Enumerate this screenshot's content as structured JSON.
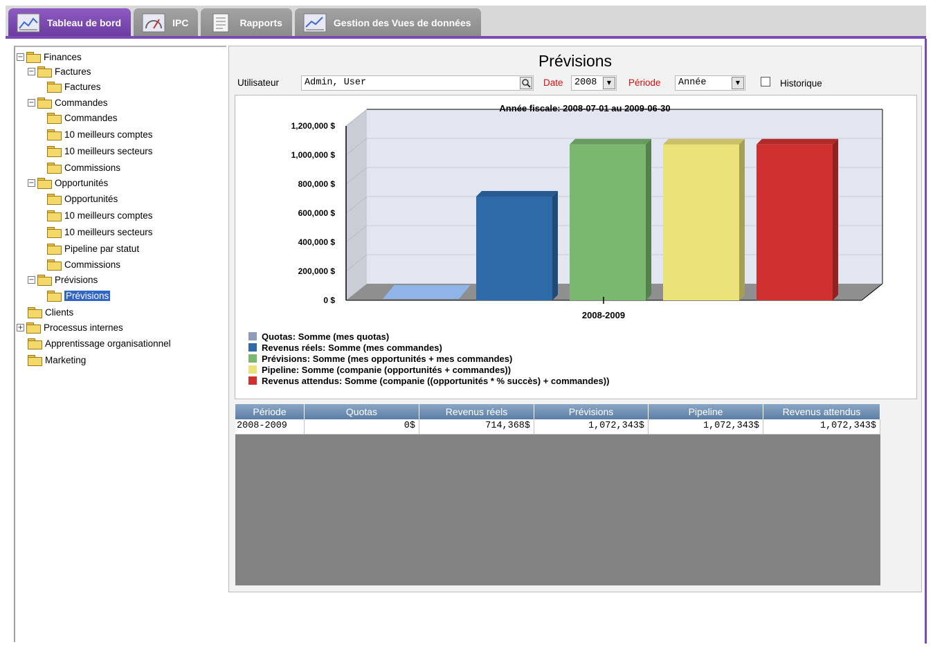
{
  "tabs": [
    {
      "label": "Tableau de bord",
      "icon": "dashboard-chart-icon",
      "active": true
    },
    {
      "label": "IPC",
      "icon": "kpi-gauge-icon",
      "active": false
    },
    {
      "label": "Rapports",
      "icon": "report-document-icon",
      "active": false
    },
    {
      "label": "Gestion des Vues de données",
      "icon": "data-views-chart-icon",
      "active": false
    }
  ],
  "tree": [
    {
      "label": "Finances",
      "level": 0,
      "expander": "−"
    },
    {
      "label": "Factures",
      "level": 1,
      "expander": "−"
    },
    {
      "label": "Factures",
      "level": 2
    },
    {
      "label": "Commandes",
      "level": 1,
      "expander": "−"
    },
    {
      "label": "Commandes",
      "level": 2
    },
    {
      "label": "10 meilleurs comptes",
      "level": 2
    },
    {
      "label": "10 meilleurs secteurs",
      "level": 2
    },
    {
      "label": "Commissions",
      "level": 2
    },
    {
      "label": "Opportunités",
      "level": 1,
      "expander": "−"
    },
    {
      "label": "Opportunités",
      "level": 2
    },
    {
      "label": "10 meilleurs comptes",
      "level": 2
    },
    {
      "label": "10 meilleurs secteurs",
      "level": 2
    },
    {
      "label": "Pipeline par statut",
      "level": 2
    },
    {
      "label": "Commissions",
      "level": 2
    },
    {
      "label": "Prévisions",
      "level": 1,
      "expander": "−"
    },
    {
      "label": "Prévisions",
      "level": 2,
      "selected": true
    },
    {
      "label": "Clients",
      "level": 0
    },
    {
      "label": "Processus internes",
      "level": 0,
      "expander": "+"
    },
    {
      "label": "Apprentissage organisationnel",
      "level": 0
    },
    {
      "label": "Marketing",
      "level": 0
    }
  ],
  "main": {
    "title": "Prévisions",
    "user_label": "Utilisateur",
    "user_value": "Admin, User",
    "date_label": "Date",
    "date_value": "2008",
    "period_label": "Période",
    "period_value": "Année",
    "history_label": "Historique",
    "history_checked": false
  },
  "chart_data": {
    "type": "bar",
    "title": "Année fiscale: 2008-07-01 au 2009-06-30",
    "categories": [
      "2008-2009"
    ],
    "series": [
      {
        "name": "Quotas: Somme (mes quotas)",
        "values": [
          0
        ],
        "color": "#8fb4e8"
      },
      {
        "name": "Revenus réels: Somme (mes commandes)",
        "values": [
          714368
        ],
        "color": "#2f6aa8"
      },
      {
        "name": "Prévisions: Somme (mes opportunités +  mes commandes)",
        "values": [
          1072343
        ],
        "color": "#7ab870"
      },
      {
        "name": "Pipeline: Somme (companie (opportunités  +  commandes))",
        "values": [
          1072343
        ],
        "color": "#ece27a"
      },
      {
        "name": "Revenus attendus: Somme (companie ((opportunités * % succès) + commandes))",
        "values": [
          1072343
        ],
        "color": "#d03030"
      }
    ],
    "legend_swatches": [
      "#8d9cb8",
      "#2f6aa8",
      "#7ab870",
      "#ece27a",
      "#d03030"
    ],
    "yticks": [
      "0 $",
      "200,000 $",
      "400,000 $",
      "600,000 $",
      "800,000 $",
      "1,000,000 $",
      "1,200,000 $"
    ],
    "ylim": [
      0,
      1200000
    ],
    "grid": true,
    "legend_position": "bottom-left"
  },
  "table": {
    "headers": [
      "Période",
      "Quotas",
      "Revenus réels",
      "Prévisions",
      "Pipeline",
      "Revenus attendus"
    ],
    "rows": [
      [
        "2008-2009",
        "0$",
        "714,368$",
        "1,072,343$",
        "1,072,343$",
        "1,072,343$"
      ]
    ]
  }
}
